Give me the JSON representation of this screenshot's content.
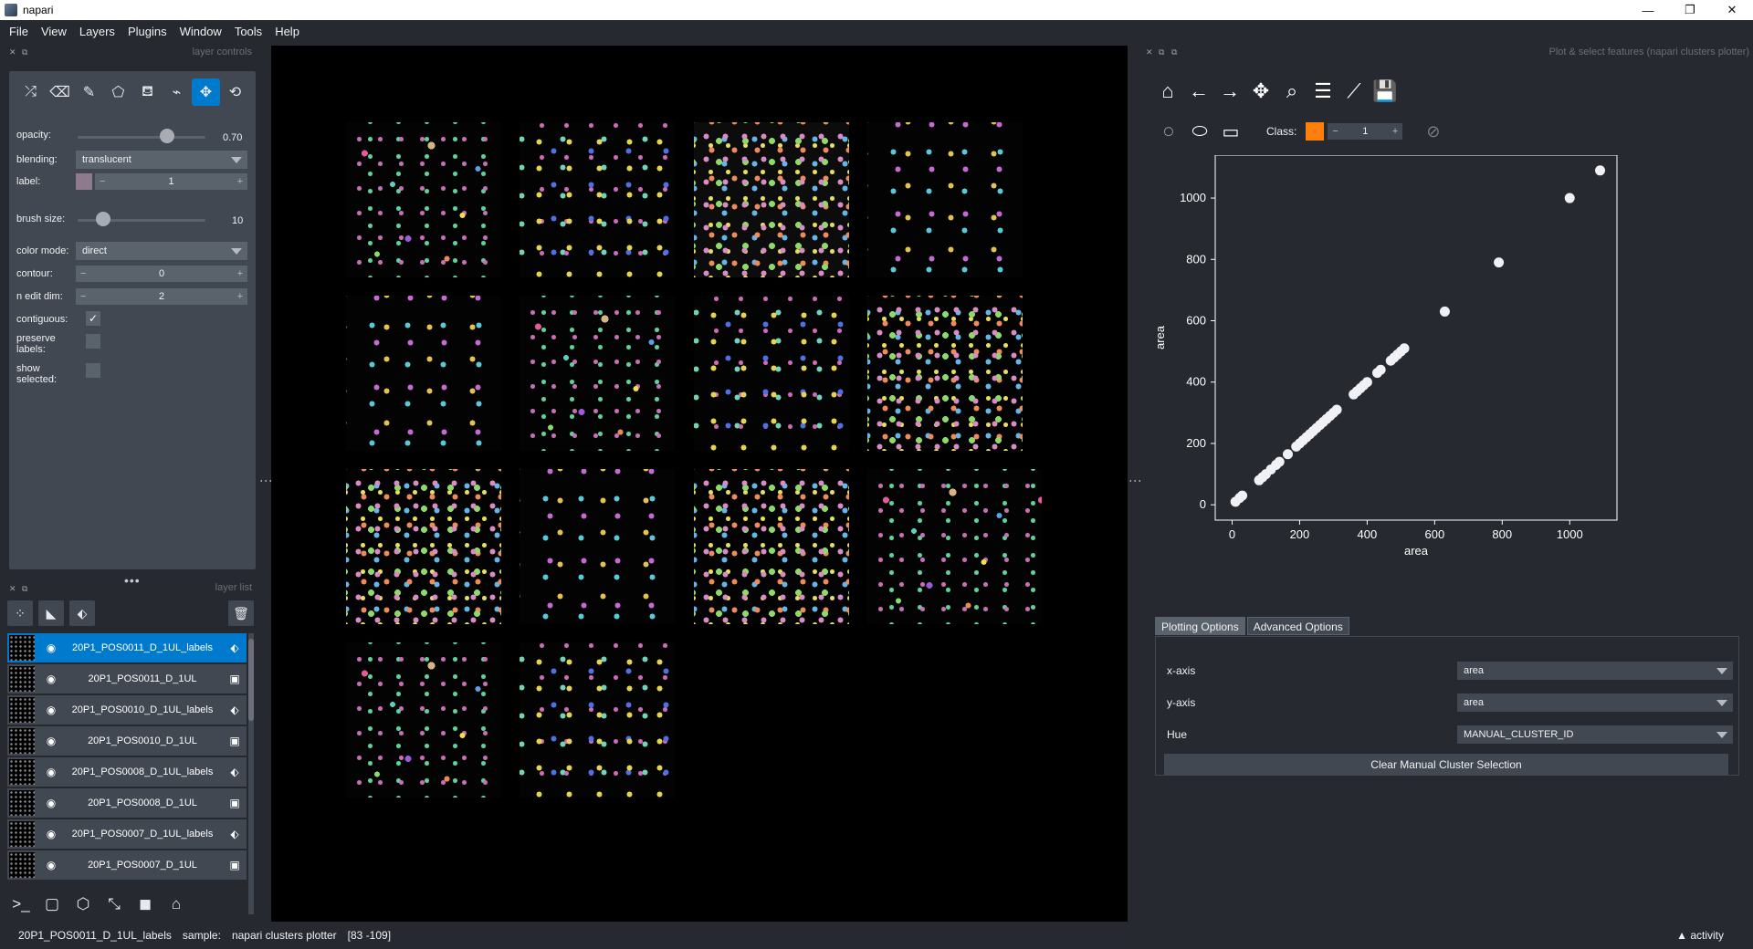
{
  "window": {
    "title": "napari",
    "controls": [
      "—",
      "❐",
      "✕"
    ]
  },
  "menu": [
    "File",
    "View",
    "Layers",
    "Plugins",
    "Window",
    "Tools",
    "Help"
  ],
  "layer_controls": {
    "title": "layer controls",
    "tools": [
      {
        "icon": "shuffle-icon",
        "glyph": "⤮"
      },
      {
        "icon": "eraser-icon",
        "glyph": "⌫"
      },
      {
        "icon": "paintbrush-icon",
        "glyph": "✎"
      },
      {
        "icon": "polygon-icon",
        "glyph": "⬠"
      },
      {
        "icon": "fill-bucket-icon",
        "glyph": "⛾"
      },
      {
        "icon": "color-picker-icon",
        "glyph": "⌁"
      },
      {
        "icon": "pan-zoom-icon",
        "glyph": "✥"
      },
      {
        "icon": "transform-icon",
        "glyph": "⟲"
      }
    ],
    "opacity_label": "opacity:",
    "opacity_value": "0.70",
    "opacity_fraction": 0.7,
    "blending_label": "blending:",
    "blending_value": "translucent",
    "label_label": "label:",
    "label_value": "1",
    "label_color": "#8d7a8c",
    "brush_label": "brush size:",
    "brush_value": "10",
    "brush_fraction": 0.2,
    "color_mode_label": "color mode:",
    "color_mode_value": "direct",
    "contour_label": "contour:",
    "contour_value": "0",
    "n_edit_label": "n edit dim:",
    "n_edit_value": "2",
    "contiguous_label": "contiguous:",
    "contiguous_checked": true,
    "preserve_label_1": "preserve",
    "preserve_label_2": "labels:",
    "show_label_1": "show",
    "show_label_2": "selected:"
  },
  "layer_list": {
    "title": "layer list",
    "layers": [
      {
        "name": "20P1_POS0011_D_1UL_labels",
        "type": "labels",
        "selected": true
      },
      {
        "name": "20P1_POS0011_D_1UL",
        "type": "image",
        "selected": false
      },
      {
        "name": "20P1_POS0010_D_1UL_labels",
        "type": "labels",
        "selected": false
      },
      {
        "name": "20P1_POS0010_D_1UL",
        "type": "image",
        "selected": false
      },
      {
        "name": "20P1_POS0008_D_1UL_labels",
        "type": "labels",
        "selected": false
      },
      {
        "name": "20P1_POS0008_D_1UL",
        "type": "image",
        "selected": false
      },
      {
        "name": "20P1_POS0007_D_1UL_labels",
        "type": "labels",
        "selected": false
      },
      {
        "name": "20P1_POS0007_D_1UL",
        "type": "image",
        "selected": false
      }
    ]
  },
  "plotter": {
    "title": "Plot & select features (napari clusters plotter)",
    "class_label": "Class:",
    "class_value": "1",
    "class_color": "#ff7f0e",
    "point_color": "#f0f0f5",
    "tabs": [
      "Plotting Options",
      "Advanced Options"
    ],
    "xaxis_label": "x-axis",
    "xaxis_value": "area",
    "yaxis_label": "y-axis",
    "yaxis_value": "area",
    "hue_label": "Hue",
    "hue_value": "MANUAL_CLUSTER_ID",
    "clear_button": "Clear Manual Cluster Selection"
  },
  "chart_data": {
    "type": "scatter",
    "xlabel": "area",
    "ylabel": "area",
    "xlim": [
      -50,
      1140
    ],
    "ylim": [
      -50,
      1140
    ],
    "xticks": [
      0,
      200,
      400,
      600,
      800,
      1000
    ],
    "yticks": [
      0,
      200,
      400,
      600,
      800,
      1000
    ],
    "grid": false,
    "points": [
      [
        10,
        10
      ],
      [
        22,
        22
      ],
      [
        30,
        30
      ],
      [
        80,
        80
      ],
      [
        90,
        90
      ],
      [
        100,
        100
      ],
      [
        115,
        115
      ],
      [
        130,
        130
      ],
      [
        140,
        140
      ],
      [
        165,
        165
      ],
      [
        190,
        190
      ],
      [
        200,
        200
      ],
      [
        210,
        210
      ],
      [
        220,
        220
      ],
      [
        230,
        230
      ],
      [
        240,
        240
      ],
      [
        250,
        250
      ],
      [
        260,
        260
      ],
      [
        270,
        270
      ],
      [
        280,
        280
      ],
      [
        290,
        290
      ],
      [
        300,
        300
      ],
      [
        310,
        310
      ],
      [
        360,
        360
      ],
      [
        370,
        370
      ],
      [
        380,
        380
      ],
      [
        390,
        390
      ],
      [
        400,
        400
      ],
      [
        430,
        430
      ],
      [
        440,
        440
      ],
      [
        470,
        470
      ],
      [
        480,
        480
      ],
      [
        490,
        490
      ],
      [
        500,
        500
      ],
      [
        510,
        510
      ],
      [
        630,
        630
      ],
      [
        790,
        790
      ],
      [
        1000,
        1000
      ],
      [
        1090,
        1090
      ]
    ]
  },
  "status": {
    "layer": "20P1_POS0011_D_1UL_labels",
    "sample_label": "sample:",
    "sample_value": "napari clusters plotter",
    "coords": "[83 -109]",
    "activity": "▲ activity"
  }
}
